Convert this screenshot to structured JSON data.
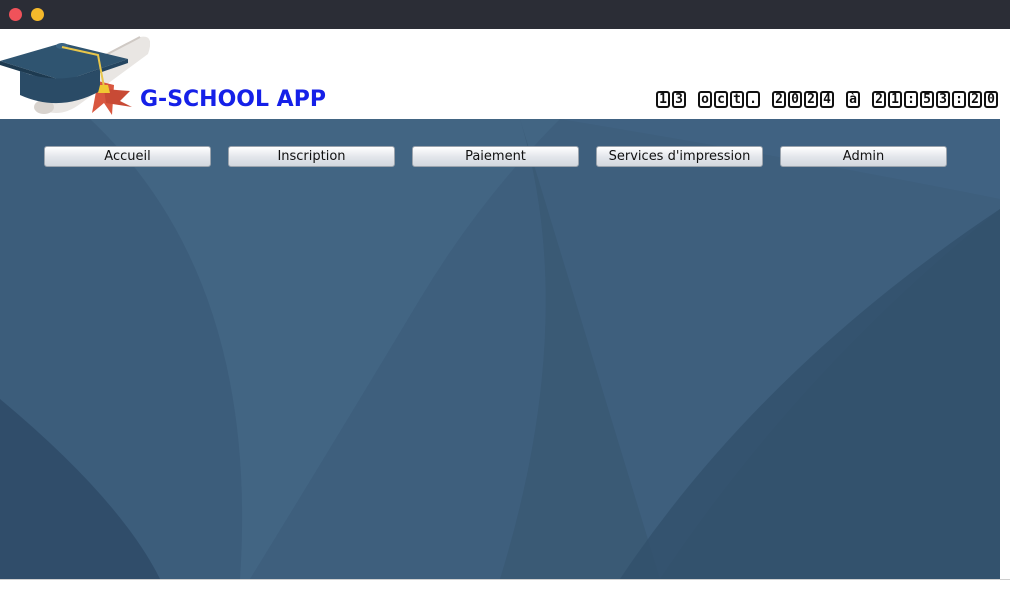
{
  "window": {
    "controls": {
      "close_icon": "close-dot-icon",
      "minimize_icon": "minimize-dot-icon",
      "close_color": "#f0525a",
      "minimize_color": "#f5b92b"
    }
  },
  "header": {
    "logo_icon": "graduation-cap-diploma-icon",
    "app_title": "G-SCHOOL APP",
    "title_color": "#1520e8",
    "datetime_chars": [
      "1",
      "3",
      " ",
      "o",
      "c",
      "t",
      ".",
      " ",
      "2",
      "0",
      "2",
      "4",
      " ",
      "à",
      " ",
      "2",
      "1",
      ":",
      "5",
      "3",
      ":",
      "2",
      "0"
    ]
  },
  "nav": {
    "buttons": [
      {
        "label": "Accueil"
      },
      {
        "label": "Inscription"
      },
      {
        "label": "Paiement"
      },
      {
        "label": "Services d'impression"
      },
      {
        "label": "Admin"
      }
    ]
  },
  "main": {
    "background_color": "#3d5d7b"
  }
}
